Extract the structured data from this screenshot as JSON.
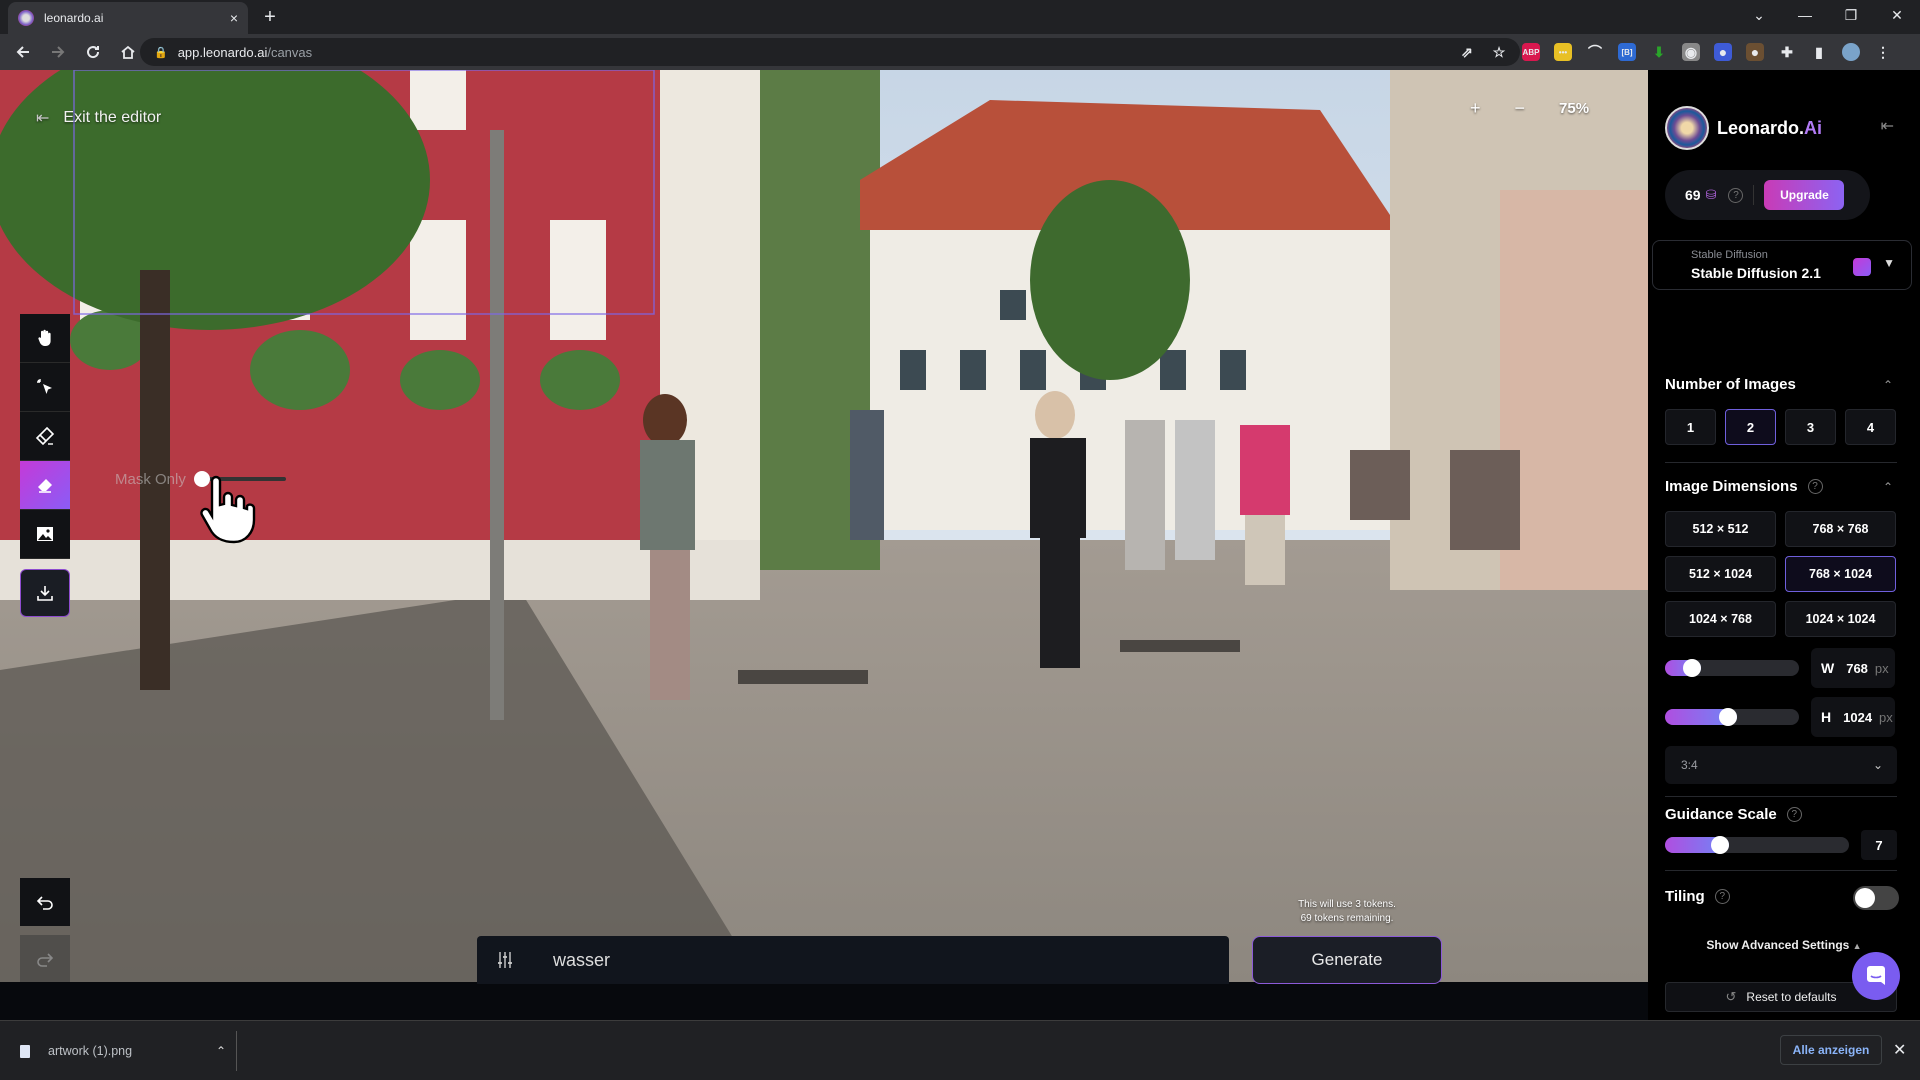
{
  "browser": {
    "tab_title": "leonardo.ai",
    "tab_close": "×",
    "new_tab": "+",
    "url_host": "app.leonardo.ai",
    "url_path": "/canvas",
    "window_controls": [
      "⌄",
      "—",
      "❐",
      "✕"
    ],
    "extensions": [
      {
        "name": "share-icon",
        "glyph": "⇗",
        "color": "transparent"
      },
      {
        "name": "bookmark-star-icon",
        "glyph": "☆",
        "color": "transparent"
      },
      {
        "name": "adblock-plus-icon",
        "glyph": "ABP",
        "color": "#d9184f"
      },
      {
        "name": "yellow-extension-icon",
        "glyph": "•••",
        "color": "#e8c025"
      },
      {
        "name": "rainbow-extension-icon",
        "glyph": "⌒",
        "color": "transparent"
      },
      {
        "name": "blue-extension-icon",
        "glyph": "[B]",
        "color": "#2e6ad3"
      },
      {
        "name": "download-arrow-extension-icon",
        "glyph": "⬇",
        "color": "transparent"
      },
      {
        "name": "camera-extension-icon",
        "glyph": "◉",
        "color": "#888"
      },
      {
        "name": "color-wheel-extension-icon",
        "glyph": "●",
        "color": "#3e5bd6"
      },
      {
        "name": "brown-extension-icon",
        "glyph": "●",
        "color": "#6b4f32"
      },
      {
        "name": "puzzle-extensions-icon",
        "glyph": "✚",
        "color": "transparent"
      },
      {
        "name": "side-panel-icon",
        "glyph": "▮",
        "color": "transparent"
      },
      {
        "name": "profile-avatar-icon",
        "glyph": "",
        "color": "#7aa3c9"
      },
      {
        "name": "menu-kebab-icon",
        "glyph": "⋮",
        "color": "transparent"
      }
    ]
  },
  "canvas": {
    "exit_label": "Exit the editor",
    "zoom_in": "+",
    "zoom_out": "−",
    "zoom_level": "75%",
    "mask_label": "Mask Only",
    "token_info_line1": "This will use 3 tokens.",
    "token_info_line2": "69 tokens remaining.",
    "prompt_value": "wasser",
    "generate_label": "Generate",
    "tools": [
      "pan",
      "select",
      "draw-mask",
      "erase",
      "image",
      "download"
    ]
  },
  "panel": {
    "brand_name": "Leonardo.",
    "brand_ai": "Ai",
    "tokens": "69",
    "upgrade_label": "Upgrade",
    "model_category": "Stable Diffusion",
    "model_name": "Stable Diffusion 2.1",
    "num_images_title": "Number of Images",
    "num_images_options": [
      "1",
      "2",
      "3",
      "4"
    ],
    "num_images_selected": "2",
    "dimensions_title": "Image Dimensions",
    "dimension_options": [
      "512 × 512",
      "768 × 768",
      "512 × 1024",
      "768 × 1024",
      "1024 × 768",
      "1024 × 1024"
    ],
    "dimension_selected": "768 × 1024",
    "width_label": "W",
    "width_value": "768",
    "height_label": "H",
    "height_value": "1024",
    "unit": "px",
    "width_slider_fraction": 0.2,
    "height_slider_fraction": 0.47,
    "aspect_ratio": "3:4",
    "guidance_title": "Guidance Scale",
    "guidance_value": "7",
    "guidance_slider_fraction": 0.3,
    "tiling_title": "Tiling",
    "tiling_on": false,
    "advanced_label": "Show Advanced Settings",
    "reset_label": "Reset to defaults",
    "help": "?"
  },
  "downloads": {
    "file_name": "artwork (1).png",
    "show_all_label": "Alle anzeigen",
    "close": "✕"
  },
  "colors": {
    "accent_gradient_start": "#c43ad8",
    "accent_gradient_end": "#8b5cf6",
    "selected_border": "#6f5fdc",
    "chat_bubble": "#7a5cf0"
  }
}
